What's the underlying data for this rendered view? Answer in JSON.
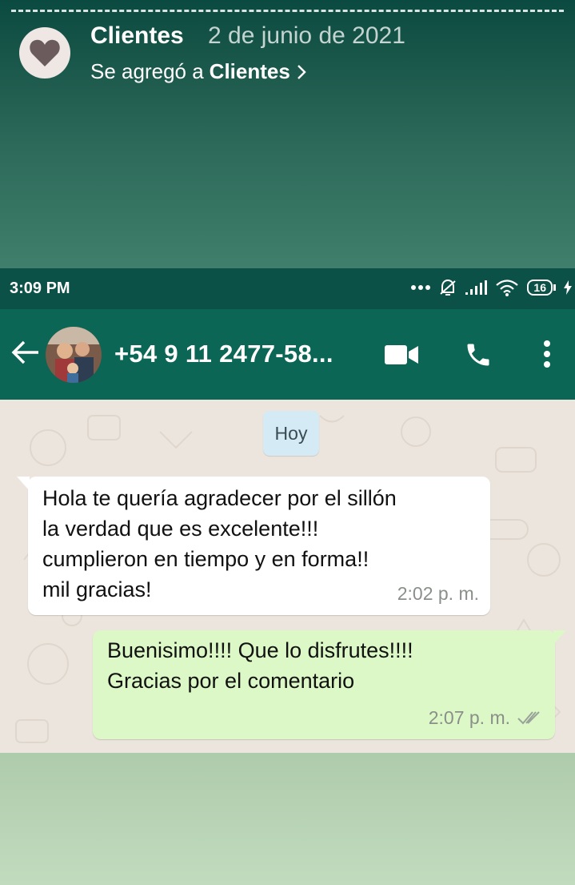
{
  "story": {
    "group_name": "Clientes",
    "date": "2 de junio de 2021",
    "subtitle_prefix": "Se agregó a",
    "subtitle_link": "Clientes",
    "avatar_icon": "heart-icon"
  },
  "status_bar": {
    "time": "3:09 PM",
    "battery": "16"
  },
  "chat_header": {
    "contact": "+54 9 11 2477-58...",
    "icons": [
      "back-arrow-icon",
      "video-call-icon",
      "phone-icon",
      "more-vert-icon"
    ]
  },
  "chat": {
    "date_chip": "Hoy",
    "messages": [
      {
        "direction": "in",
        "text": "Hola te quería agradecer por el  sillón\nla verdad que es excelente!!!\ncumplieron en tiempo y en forma!!\nmil gracias!",
        "time": "2:02 p. m."
      },
      {
        "direction": "out",
        "text": "Buenisimo!!!! Que lo disfrutes!!!!\nGracias por el comentario",
        "time": "2:07 p. m."
      }
    ]
  },
  "colors": {
    "header": "#0b6655",
    "status_bar": "#0b5147",
    "outgoing_bubble": "#dcf8c6",
    "chat_background": "#ece5dd"
  }
}
